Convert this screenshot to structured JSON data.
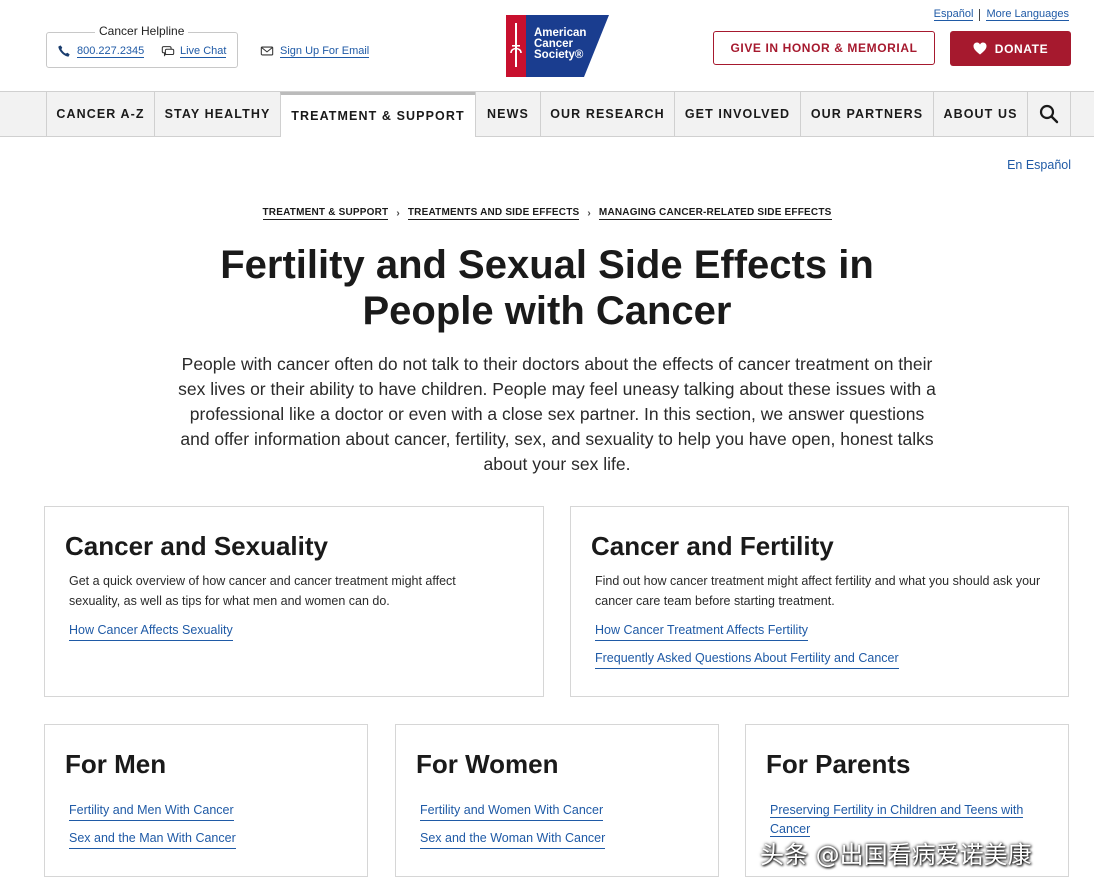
{
  "header": {
    "helpline": {
      "title": "Cancer Helpline",
      "phone": "800.227.2345",
      "chat": "Live Chat"
    },
    "signup": "Sign Up For Email",
    "logo": {
      "line1": "American",
      "line2": "Cancer",
      "line3": "Society®"
    },
    "languages": {
      "espanol": "Español",
      "more": "More Languages"
    },
    "honor_button": "GIVE IN HONOR & MEMORIAL",
    "donate_button": "DONATE"
  },
  "nav": {
    "items": [
      {
        "label": "CANCER A-Z"
      },
      {
        "label": "STAY HEALTHY"
      },
      {
        "label": "TREATMENT & SUPPORT"
      },
      {
        "label": "NEWS"
      },
      {
        "label": "OUR RESEARCH"
      },
      {
        "label": "GET INVOLVED"
      },
      {
        "label": "OUR PARTNERS"
      },
      {
        "label": "ABOUT US"
      }
    ],
    "active": "TREATMENT & SUPPORT"
  },
  "en_espanol": "En Español",
  "breadcrumb": [
    "TREATMENT & SUPPORT",
    "TREATMENTS AND SIDE EFFECTS",
    "MANAGING CANCER-RELATED SIDE EFFECTS"
  ],
  "page": {
    "title_line1": "Fertility and Sexual Side Effects in",
    "title_line2": "People with Cancer",
    "intro": "People with cancer often do not talk to their doctors about the effects of cancer treatment on their sex lives or their ability to have children. People may feel uneasy talking about these issues with a professional like a doctor or even with a close sex partner. In this section, we answer questions and offer information about cancer, fertility, sex, and sexuality to help you have open, honest talks about your sex life."
  },
  "cards": {
    "sexuality": {
      "title": "Cancer and Sexuality",
      "desc": "Get a quick overview of how cancer and cancer treatment might affect sexuality, as well as tips for what men and women can do.",
      "links": [
        "How Cancer Affects Sexuality"
      ]
    },
    "fertility": {
      "title": "Cancer and Fertility",
      "desc": "Find out how cancer treatment might affect fertility and what you should ask your cancer care team before starting treatment.",
      "links": [
        "How Cancer Treatment Affects Fertility",
        "Frequently Asked Questions About Fertility and Cancer"
      ]
    },
    "men": {
      "title": "For Men",
      "links": [
        "Fertility and Men With Cancer",
        "Sex and the Man With Cancer"
      ]
    },
    "women": {
      "title": "For Women",
      "links": [
        "Fertility and Women With Cancer",
        "Sex and the Woman With Cancer"
      ]
    },
    "parents": {
      "title": "For Parents",
      "links": [
        "Preserving Fertility in Children and Teens with Cancer"
      ]
    }
  },
  "watermark": "头条 @出国看病爱诺美康",
  "colors": {
    "brand_red": "#a6192e",
    "brand_blue": "#1f5aa6",
    "link": "#1f5aa6"
  },
  "icons": [
    "phone-icon",
    "chat-icon",
    "mail-icon",
    "heart-icon",
    "search-icon",
    "sword-icon"
  ]
}
